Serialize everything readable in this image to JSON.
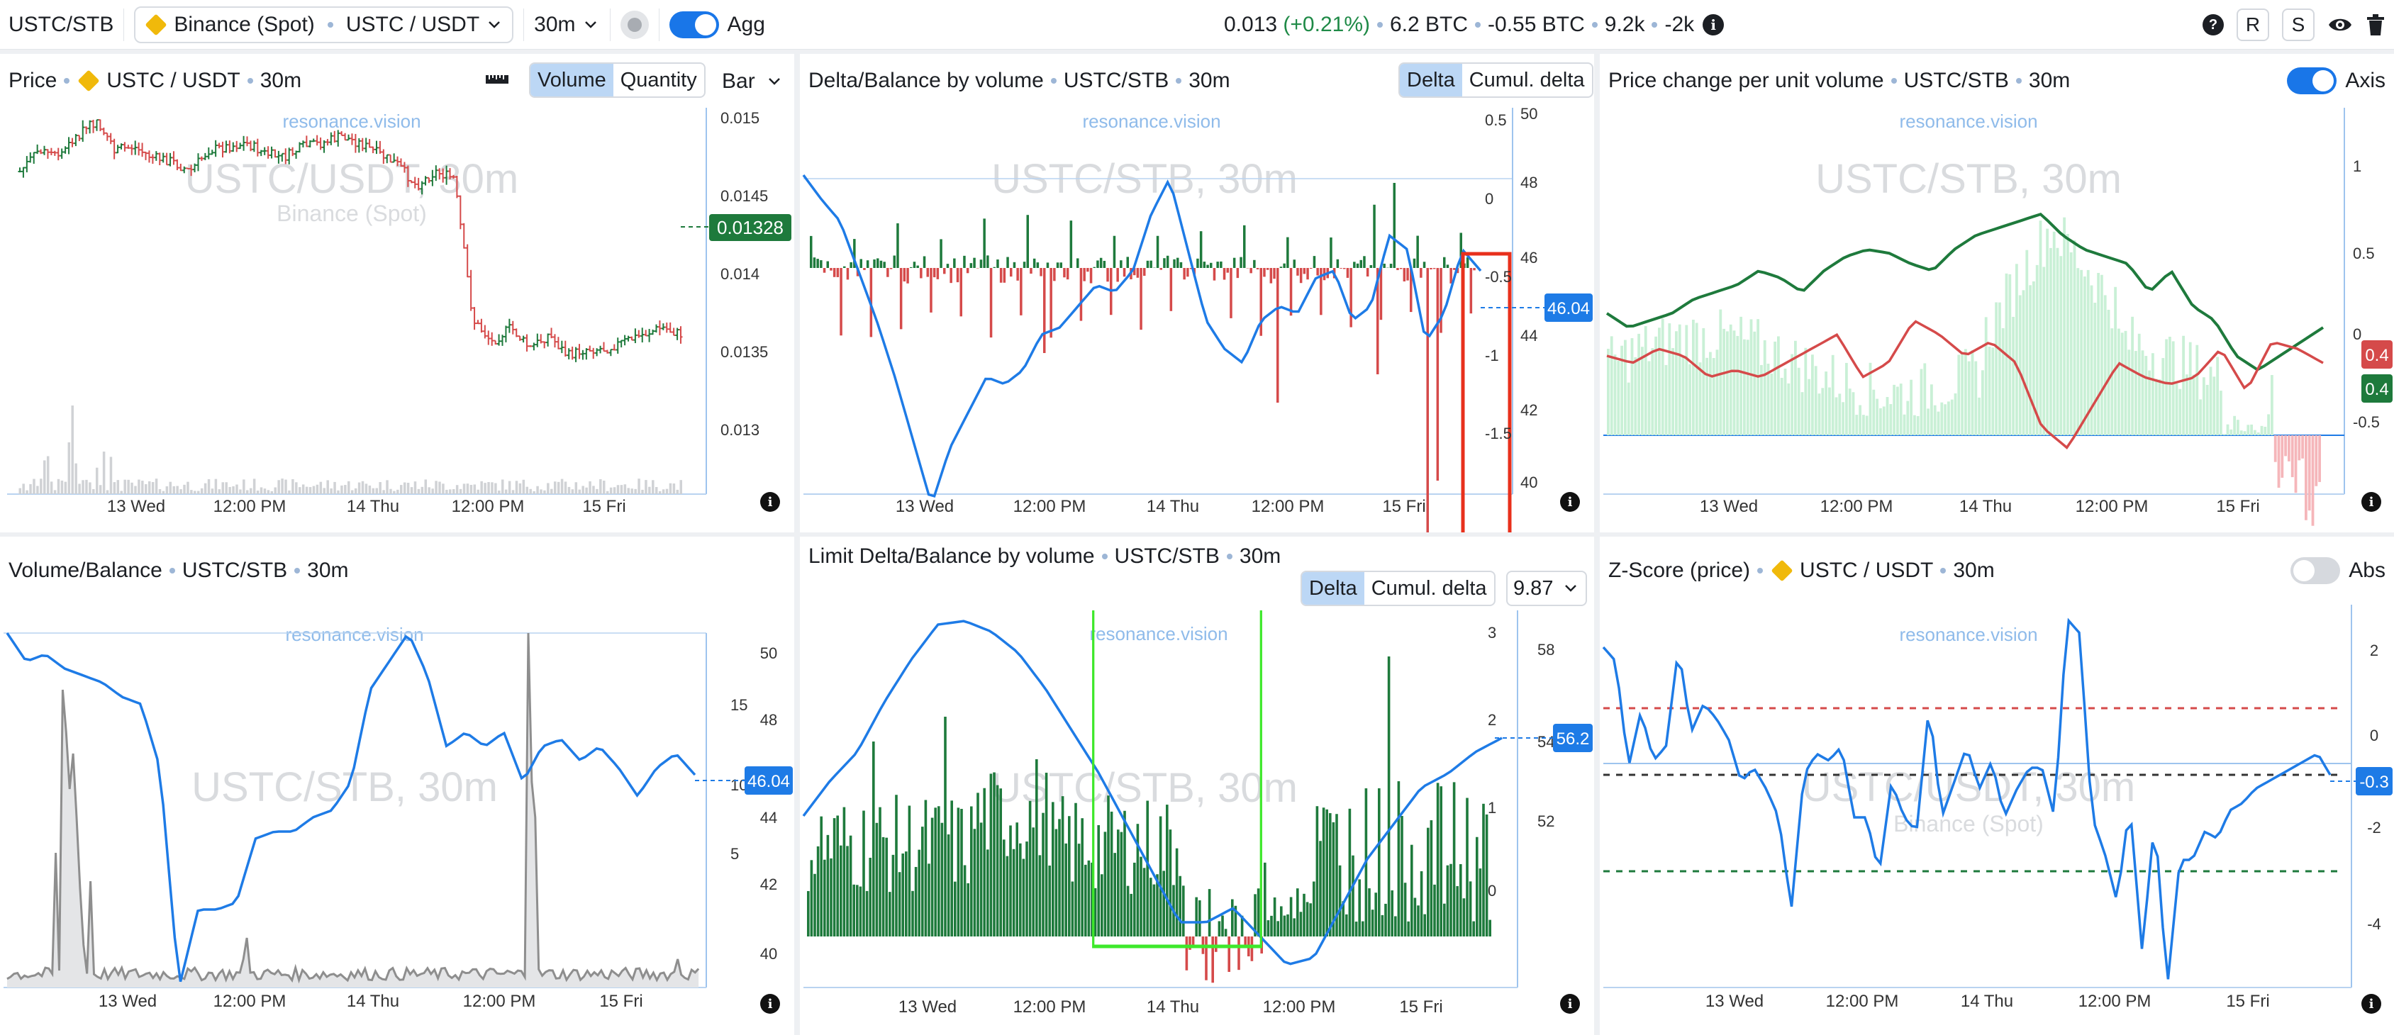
{
  "topbar": {
    "symbol": "USTC/STB",
    "exchange": "Binance (Spot)",
    "pair": "USTC / USDT",
    "interval": "30m",
    "agg": "Agg",
    "stats": {
      "price": "0.013",
      "change": "(+0.21%)",
      "vol": "6.2 BTC",
      "delta": "-0.55 BTC",
      "trades": "9.2k",
      "tdelta": "-2k"
    },
    "btn_r": "R",
    "btn_s": "S",
    "help": "?"
  },
  "colors": {
    "up": "#1e7a3c",
    "down": "#d54a4a",
    "line": "#1e7be6",
    "green_box": "#3ee82b",
    "red_box": "#e8301c",
    "watermark": "#d9dbde"
  },
  "icons": [
    "binance-icon",
    "chevron-down-icon",
    "record-icon",
    "help-icon",
    "eye-icon",
    "trash-icon",
    "ruler-icon",
    "info-icon"
  ],
  "panels": {
    "price": {
      "title": "Price",
      "pair": "USTC / USDT",
      "interval": "30m",
      "seg": [
        "Volume",
        "Quantity"
      ],
      "type": "Bar",
      "watermark": "USTC/USDT, 30m",
      "watermark2": "Binance (Spot)",
      "brand": "resonance.vision",
      "yticks": [
        "0.015",
        "0.0145",
        "0.014",
        "0.0135",
        "0.013"
      ],
      "last": "0.01328",
      "xticks": [
        "13 Wed",
        "12:00 PM",
        "14 Thu",
        "12:00 PM",
        "15 Fri"
      ]
    },
    "delta": {
      "title": "Delta/Balance by volume",
      "pair": "USTC/STB",
      "interval": "30m",
      "seg": [
        "Delta",
        "Cumul. delta"
      ],
      "watermark": "USTC/STB, 30m",
      "brand": "resonance.vision",
      "yleft": [
        "0.5",
        "0",
        "-0.5",
        "-1",
        "-1.5"
      ],
      "yright": [
        "50",
        "48",
        "46",
        "44",
        "42",
        "40"
      ],
      "last": "46.04",
      "xticks": [
        "13 Wed",
        "12:00 PM",
        "14 Thu",
        "12:00 PM",
        "15 Fri"
      ]
    },
    "pcpv": {
      "title": "Price change per unit volume",
      "pair": "USTC/STB",
      "interval": "30m",
      "axis": "Axis",
      "watermark": "USTC/STB, 30m",
      "brand": "resonance.vision",
      "yticks": [
        "1",
        "0.5",
        "0",
        "-0.5"
      ],
      "last_red": "0.4",
      "last_green": "0.4",
      "xticks": [
        "13 Wed",
        "12:00 PM",
        "14 Thu",
        "12:00 PM",
        "15 Fri"
      ]
    },
    "volbal": {
      "title": "Volume/Balance",
      "pair": "USTC/STB",
      "interval": "30m",
      "watermark": "USTC/STB, 30m",
      "brand": "resonance.vision",
      "yleft": [
        "15",
        "10",
        "5"
      ],
      "yright": [
        "50",
        "48",
        "44",
        "42",
        "40"
      ],
      "last": "46.04",
      "xticks": [
        "13 Wed",
        "12:00 PM",
        "14 Thu",
        "12:00 PM",
        "15 Fri"
      ]
    },
    "limit": {
      "title": "Limit Delta/Balance by volume",
      "pair": "USTC/STB",
      "interval": "30m",
      "seg": [
        "Delta",
        "Cumul. delta"
      ],
      "select": "9.87",
      "watermark": "USTC/STB, 30m",
      "brand": "resonance.vision",
      "yleft": [
        "3",
        "2",
        "1",
        "0"
      ],
      "yright": [
        "58",
        "54",
        "52"
      ],
      "last": "56.2",
      "xticks": [
        "13 Wed",
        "12:00 PM",
        "14 Thu",
        "12:00 PM",
        "15 Fri"
      ]
    },
    "zscore": {
      "title": "Z-Score (price)",
      "pair": "USTC / USDT",
      "interval": "30m",
      "abs": "Abs",
      "watermark": "USTC/USDT, 30m",
      "watermark2": "Binance (Spot)",
      "brand": "resonance.vision",
      "yticks": [
        "2",
        "0",
        "-2",
        "-4"
      ],
      "last": "-0.3",
      "xticks": [
        "13 Wed",
        "12:00 PM",
        "14 Thu",
        "12:00 PM",
        "15 Fri"
      ]
    }
  }
}
